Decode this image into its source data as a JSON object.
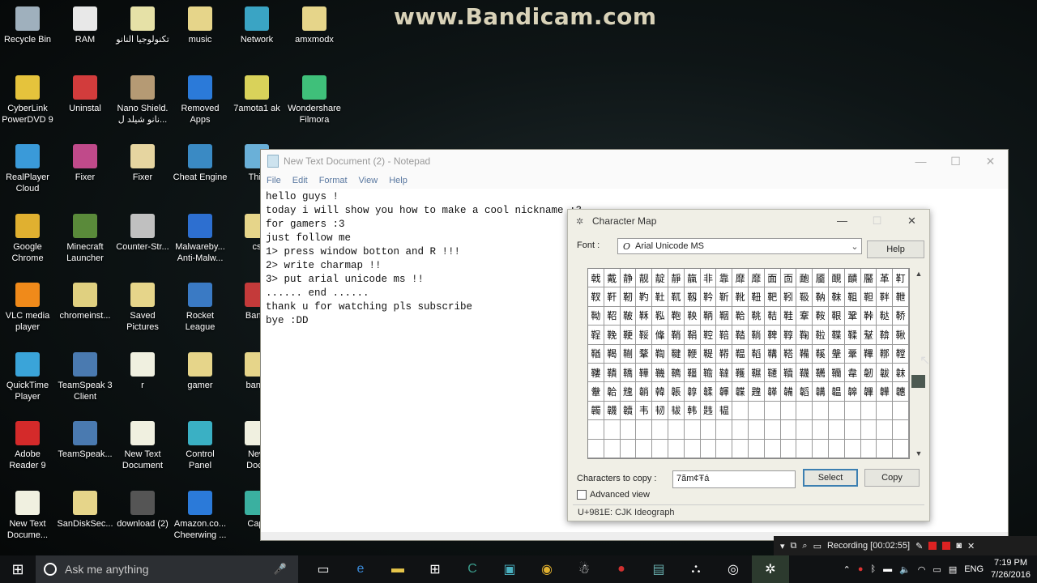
{
  "watermark": "www.Bandicam.com",
  "desktop_icons": [
    {
      "label": "Recycle Bin",
      "icon": "recycle-bin-icon",
      "color": "#9fb0bd"
    },
    {
      "label": "RAM",
      "icon": "document-icon",
      "color": "#e8e8e8"
    },
    {
      "label": "تكنولوجيا النانو",
      "icon": "folder-icon",
      "color": "#e6e1a7"
    },
    {
      "label": "music",
      "icon": "folder-icon",
      "color": "#e6d58a"
    },
    {
      "label": "Network",
      "icon": "network-icon",
      "color": "#3aa4c4"
    },
    {
      "label": "amxmodx",
      "icon": "folder-icon",
      "color": "#e6d58a"
    },
    {
      "label": "CyberLink\nPowerDVD 9",
      "icon": "powerdvd-icon",
      "color": "#e5c33c"
    },
    {
      "label": "Uninstal",
      "icon": "uninstall-icon",
      "color": "#d23c3c"
    },
    {
      "label": "Nano Shield.\nنانو شيلد ل...",
      "icon": "image-icon",
      "color": "#b59a74"
    },
    {
      "label": "Removed\nApps",
      "icon": "edge-icon",
      "color": "#2b7ad9"
    },
    {
      "label": "7amota1 ak",
      "icon": "user-folder-icon",
      "color": "#d9d25a"
    },
    {
      "label": "Wondershare\nFilmora",
      "icon": "filmora-icon",
      "color": "#3fc07a"
    },
    {
      "label": "RealPlayer\nCloud",
      "icon": "realplayer-icon",
      "color": "#3a9ad9"
    },
    {
      "label": "Fixer",
      "icon": "archive-icon",
      "color": "#c04a8a"
    },
    {
      "label": "Fixer",
      "icon": "image-icon",
      "color": "#e6d5a0"
    },
    {
      "label": "Cheat Engine",
      "icon": "cheat-engine-icon",
      "color": "#3a8ac4"
    },
    {
      "label": "This",
      "icon": "computer-icon",
      "color": "#6ab0d8"
    },
    {
      "label": "Google\nChrome",
      "icon": "chrome-icon",
      "color": "#e0b030"
    },
    {
      "label": "Minecraft\nLauncher",
      "icon": "minecraft-icon",
      "color": "#5a8a3a"
    },
    {
      "label": "Counter-Str...",
      "icon": "counter-strike-icon",
      "color": "#c0c0c0"
    },
    {
      "label": "Malwareby...\nAnti-Malw...",
      "icon": "malwarebytes-icon",
      "color": "#2d6fd0"
    },
    {
      "label": "cs",
      "icon": "folder-icon",
      "color": "#e6d58a"
    },
    {
      "label": "VLC media\nplayer",
      "icon": "vlc-icon",
      "color": "#f08a1a"
    },
    {
      "label": "chromeinst...",
      "icon": "installer-icon",
      "color": "#e0d080"
    },
    {
      "label": "Saved\nPictures",
      "icon": "folder-icon",
      "color": "#e6d58a"
    },
    {
      "label": "Rocket\nLeague",
      "icon": "rocket-league-icon",
      "color": "#3a7ac4"
    },
    {
      "label": "Bandi",
      "icon": "bandicam-icon",
      "color": "#c43a3a"
    },
    {
      "label": "QuickTime\nPlayer",
      "icon": "quicktime-icon",
      "color": "#3aa4d9"
    },
    {
      "label": "TeamSpeak 3\nClient",
      "icon": "teamspeak-icon",
      "color": "#4a7ab0"
    },
    {
      "label": "r",
      "icon": "document-icon",
      "color": "#f0f0e0"
    },
    {
      "label": "gamer",
      "icon": "shortcut-icon",
      "color": "#e6d58a"
    },
    {
      "label": "bandi",
      "icon": "folder-icon",
      "color": "#e6d58a"
    },
    {
      "label": "Adobe\nReader 9",
      "icon": "adobe-reader-icon",
      "color": "#d42a2a"
    },
    {
      "label": "TeamSpeak...",
      "icon": "teamspeak-icon",
      "color": "#4a7ab0"
    },
    {
      "label": "New Text\nDocument",
      "icon": "document-icon",
      "color": "#f0f0e0"
    },
    {
      "label": "Control\nPanel",
      "icon": "control-panel-icon",
      "color": "#3ab0c4"
    },
    {
      "label": "New\nDocu",
      "icon": "document-icon",
      "color": "#f0f0e0"
    },
    {
      "label": "New Text\nDocume...",
      "icon": "document-icon",
      "color": "#f0f0e0"
    },
    {
      "label": "SanDiskSec...",
      "icon": "folder-icon",
      "color": "#e6d58a"
    },
    {
      "label": "download (2)",
      "icon": "file-icon",
      "color": "#555555"
    },
    {
      "label": "Amazon.co...\nCheerwing ...",
      "icon": "edge-icon",
      "color": "#2b7ad9"
    },
    {
      "label": "Capt",
      "icon": "image-icon",
      "color": "#3ab0a0"
    }
  ],
  "notepad": {
    "title": "New Text Document (2) - Notepad",
    "menu": [
      "File",
      "Edit",
      "Format",
      "View",
      "Help"
    ],
    "text": "hello guys !\ntoday i will show you how to make a cool nickname :3\nfor gamers :3\njust follow me\n1> press window botton and R !!!\n2> write charmap !!\n3> put arial unicode ms !!\n...... end ......\nthank u for watching pls subscribe\nbye :DD"
  },
  "charmap": {
    "title": "Character Map",
    "font_label": "Font :",
    "font_value": "Arial Unicode MS",
    "help_label": "Help",
    "chars": [
      "戟",
      "戴",
      "静",
      "靓",
      "靛",
      "靜",
      "靝",
      "非",
      "靠",
      "靡",
      "靡",
      "面",
      "靣",
      "靤",
      "靥",
      "靦",
      "靧",
      "靨",
      "革",
      "靪",
      "靫",
      "靬",
      "靭",
      "靮",
      "靯",
      "靰",
      "靱",
      "靲",
      "靳",
      "靴",
      "靵",
      "靶",
      "靷",
      "靸",
      "靹",
      "靺",
      "靻",
      "靼",
      "靽",
      "靾",
      "靿",
      "鞀",
      "鞁",
      "鞂",
      "鞃",
      "鞄",
      "鞅",
      "鞆",
      "鞇",
      "鞈",
      "鞉",
      "鞊",
      "鞋",
      "鞌",
      "鞍",
      "鞎",
      "鞏",
      "鞐",
      "鞑",
      "鞒",
      "鞓",
      "鞔",
      "鞕",
      "鞖",
      "鞗",
      "鞘",
      "鞙",
      "鞚",
      "鞛",
      "鞜",
      "鞝",
      "鞞",
      "鞟",
      "鞠",
      "鞡",
      "鞢",
      "鞣",
      "鞤",
      "鞥",
      "鞦",
      "鞧",
      "鞨",
      "鞩",
      "鞪",
      "鞫",
      "鞬",
      "鞭",
      "鞮",
      "鞯",
      "鞰",
      "鞱",
      "鞲",
      "鞳",
      "鞴",
      "鞵",
      "鞶",
      "鞷",
      "鞸",
      "鞹",
      "鞺",
      "鞻",
      "鞼",
      "鞽",
      "鞾",
      "鞿",
      "韀",
      "韁",
      "韂",
      "韃",
      "韄",
      "韅",
      "韆",
      "韇",
      "韈",
      "韉",
      "韊",
      "韋",
      "韌",
      "韍",
      "韎",
      "韏",
      "韐",
      "韑",
      "韒",
      "韓",
      "韔",
      "韕",
      "韖",
      "韗",
      "韘",
      "韙",
      "韚",
      "韛",
      "韜",
      "韝",
      "韞",
      "韟",
      "韠",
      "韡",
      "韢",
      "韣",
      "韤",
      "韥",
      "韦",
      "韧",
      "韨",
      "韩",
      "韪",
      "韫"
    ],
    "copy_label": "Characters to copy :",
    "copy_value": "7ãm¢Ŧá",
    "select_label": "Select",
    "copy_button_label": "Copy",
    "advanced_label": "Advanced view",
    "status": "U+981E: CJK Ideograph"
  },
  "recording": {
    "text": "Recording [00:02:55]"
  },
  "taskbar": {
    "search_placeholder": "Ask me anything",
    "language": "ENG",
    "time": "7:19 PM",
    "date": "7/26/2016"
  }
}
